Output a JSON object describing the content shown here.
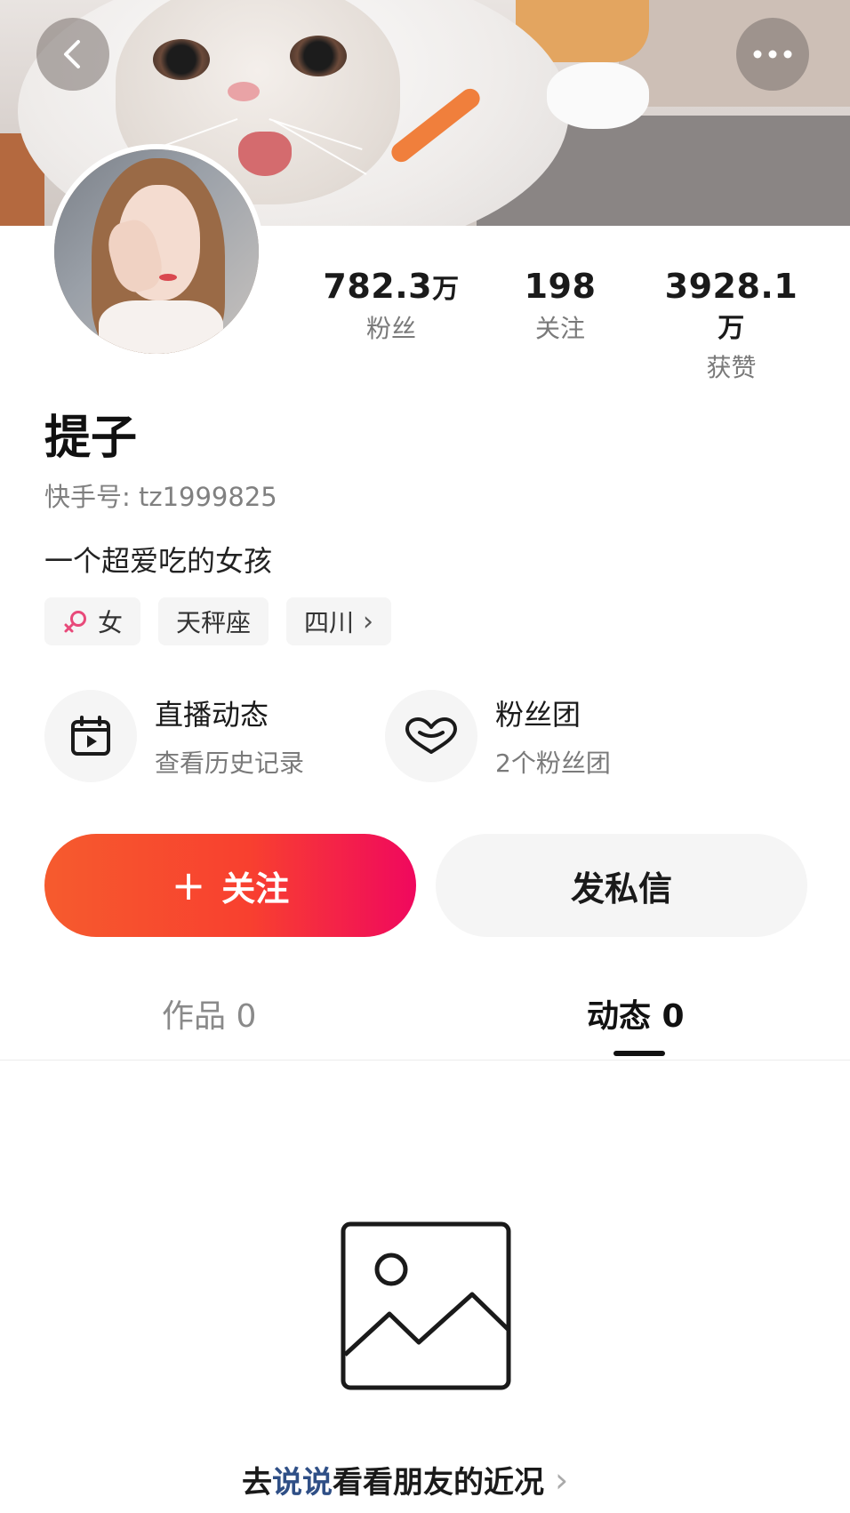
{
  "header": {
    "back_icon": "chevron-left-icon",
    "more_icon": "more-dots-icon"
  },
  "profile": {
    "name": "提子",
    "kuaishou_id": "快手号: tz1999825",
    "bio": "一个超爱吃的女孩"
  },
  "stats": [
    {
      "value": "782.3",
      "unit": "万",
      "label": "粉丝"
    },
    {
      "value": "198",
      "unit": "",
      "label": "关注"
    },
    {
      "value": "3928.1",
      "unit": "万",
      "label": "获赞"
    }
  ],
  "tags": [
    {
      "icon": "female-icon",
      "label": "女",
      "color": "#e84a7a"
    },
    {
      "label": "天秤座"
    },
    {
      "label": "四川",
      "chevron": "›"
    }
  ],
  "features": [
    {
      "icon": "calendar-play-icon",
      "title": "直播动态",
      "subtitle": "查看历史记录"
    },
    {
      "icon": "heart-outline-icon",
      "title": "粉丝团",
      "subtitle": "2个粉丝团"
    }
  ],
  "actions": {
    "follow_label": "关注",
    "follow_plus": "+",
    "message_label": "发私信",
    "follow_gradient_start": "#f65b2e",
    "follow_gradient_end": "#f0085e"
  },
  "tabs": [
    {
      "label": "作品 0",
      "active": false
    },
    {
      "label": "动态 0",
      "active": true
    }
  ],
  "empty_state": {
    "icon": "image-placeholder-icon",
    "cta_prefix": "去",
    "cta_highlight": "说说",
    "cta_suffix": "看看朋友的近况",
    "cta_chevron": "›",
    "highlight_color": "#2f4f86"
  }
}
